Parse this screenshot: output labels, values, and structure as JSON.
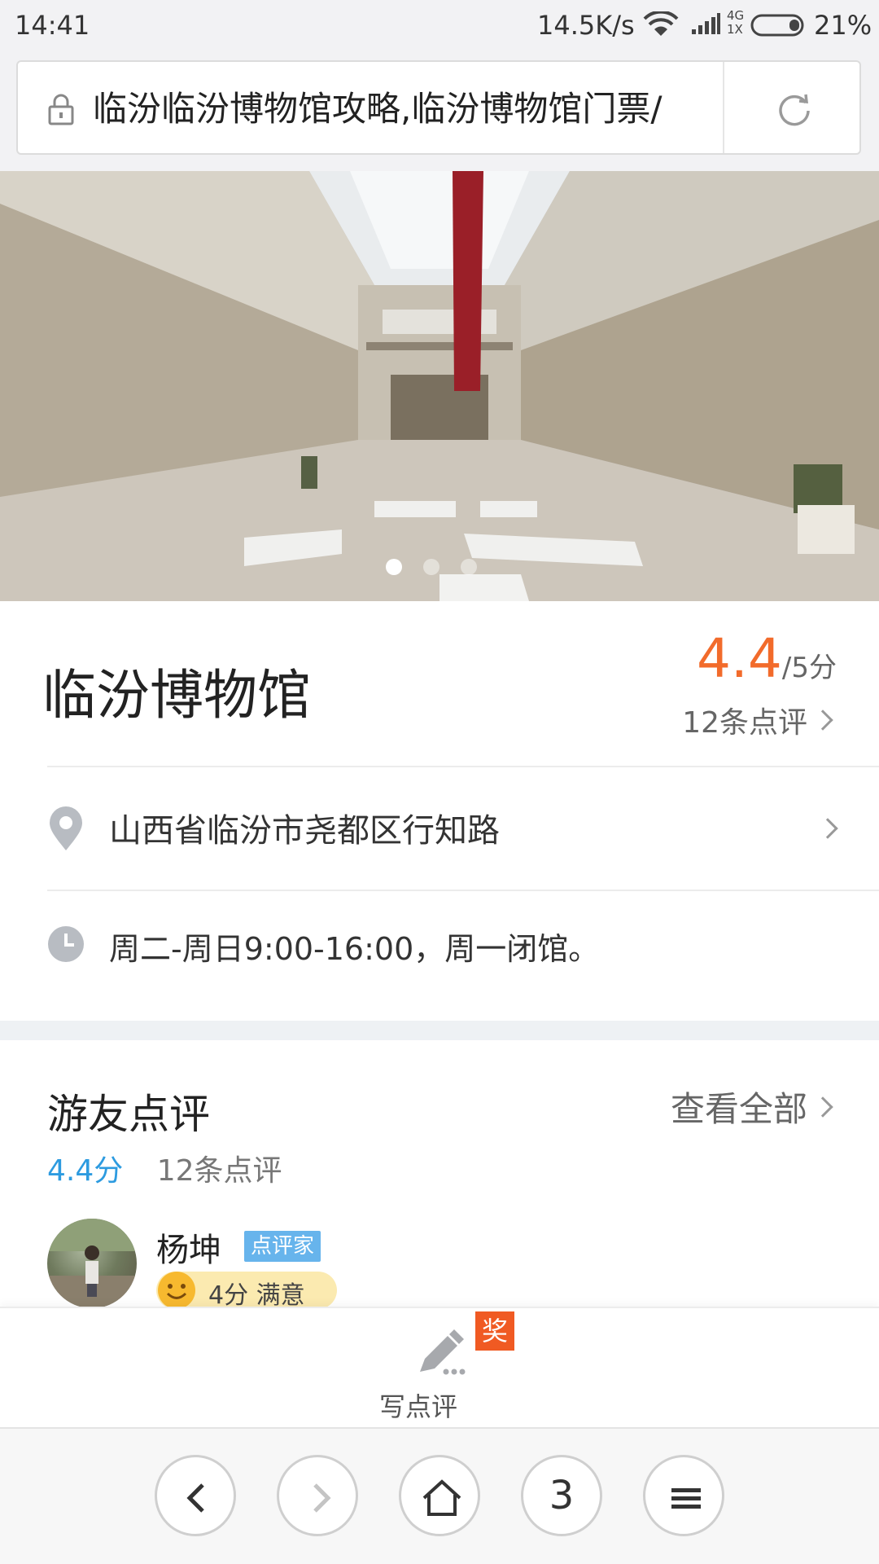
{
  "status_bar": {
    "time": "14:41",
    "speed": "14.5K/s",
    "network_top": "4G",
    "network_bottom": "1X",
    "battery": "21%"
  },
  "address_bar": {
    "url_text": "临汾临汾博物馆攻略,临汾博物馆门票/",
    "icons": [
      "lock-icon",
      "reload-icon"
    ]
  },
  "carousel": {
    "slide_count": 3,
    "active_index": 0
  },
  "poi": {
    "name": "临汾博物馆",
    "rating": "4.4",
    "rating_suffix": "/5分",
    "review_link": "12条点评",
    "address": "山西省临汾市尧都区行知路",
    "hours": "周二-周日9:00-16:00，周一闭馆。"
  },
  "reviews": {
    "section_title": "游友点评",
    "view_all": "查看全部",
    "score": "4.4分",
    "count": "12条点评",
    "first": {
      "user": "杨坤",
      "badge": "点评家",
      "satisfaction": "4分 满意"
    }
  },
  "write_review": {
    "label": "写点评",
    "award": "奖"
  },
  "browser_nav": {
    "tab_count": "3",
    "buttons": [
      "back-icon",
      "forward-icon",
      "home-icon",
      "tabs-count",
      "menu-icon"
    ]
  },
  "colors": {
    "accent_orange": "#f26b2b",
    "score_blue": "#2d9be0",
    "badge_blue": "#67b4ec",
    "award_orange": "#f05a23"
  }
}
